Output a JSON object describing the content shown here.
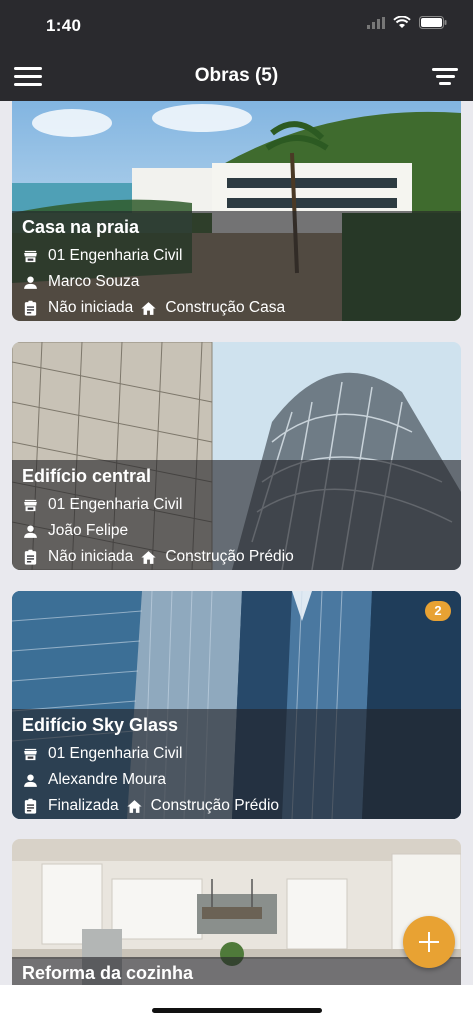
{
  "status": {
    "time": "1:40"
  },
  "nav": {
    "title": "Obras (5)"
  },
  "icons": {
    "menu": "hamburger-icon",
    "filter": "filter-icon",
    "company": "store-icon",
    "person": "person-icon",
    "status": "clipboard-icon",
    "type": "home-icon",
    "add": "plus-icon"
  },
  "colors": {
    "bar": "#2a2a2e",
    "accent": "#e8a233",
    "overlay": "rgba(35,35,40,0.62)"
  },
  "cards": [
    {
      "title": "Casa na praia",
      "company": "01 Engenharia Civil",
      "person": "Marco Souza",
      "status": "Não iniciada",
      "type": "Construção Casa"
    },
    {
      "title": "Edifício central",
      "company": "01 Engenharia Civil",
      "person": "João Felipe",
      "status": "Não iniciada",
      "type": "Construção Prédio"
    },
    {
      "title": "Edifício Sky Glass",
      "company": "01 Engenharia Civil",
      "person": "Alexandre Moura",
      "status": "Finalizada",
      "type": "Construção Prédio",
      "badge": "2"
    },
    {
      "title": "Reforma da cozinha"
    }
  ]
}
